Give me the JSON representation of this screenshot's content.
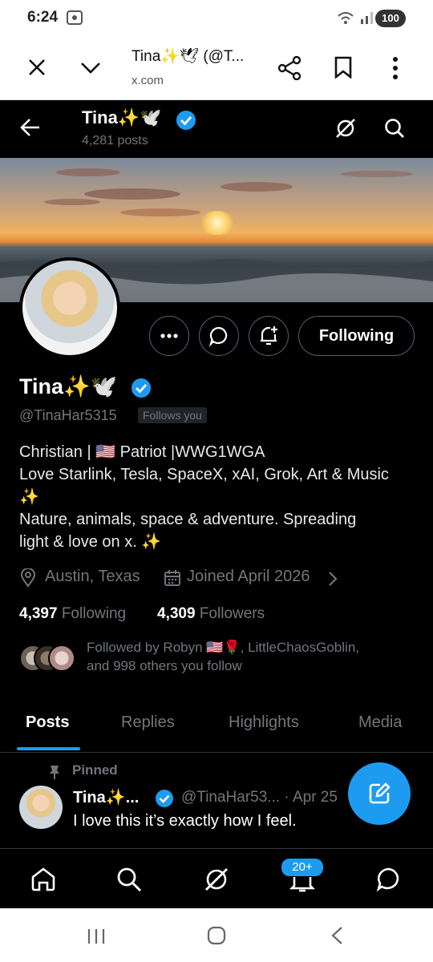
{
  "status_bar": {
    "time": "6:24",
    "battery": "100"
  },
  "custom_tab": {
    "title": "Tina✨🕊 (@T...",
    "url": "x.com"
  },
  "header": {
    "name": "Tina✨🕊️",
    "post_count": "4,281 posts"
  },
  "profile": {
    "name": "Tina✨🕊️",
    "handle": "@TinaHar5315",
    "follows_you": "Follows you",
    "follow_button": "Following",
    "bio": [
      "Christian | 🇺🇸 Patriot |WWG1WGA",
      "Love Starlink, Tesla, SpaceX, xAI, Grok, Art & Music",
      "✨",
      "Nature, animals, space & adventure. Spreading",
      "light & love on x. ✨"
    ],
    "location": "Austin, Texas",
    "joined": "Joined April 2026",
    "following_count": "4,397",
    "following_label": "Following",
    "followers_count": "4,309",
    "followers_label": "Followers",
    "followed_by_line1": "Followed by Robyn 🇺🇸🌹, LittleChaosGoblin,",
    "followed_by_line2": "and 998 others you follow"
  },
  "tabs": [
    "Posts",
    "Replies",
    "Highlights",
    "Media"
  ],
  "active_tab": "Posts",
  "pinned_post": {
    "pinned_label": "Pinned",
    "author": "Tina✨...",
    "handle_date": "@TinaHar53... · Apr 25",
    "text": "I love this it’s exactly how I feel."
  },
  "bottom_nav": {
    "notifications_badge": "20+"
  },
  "icons": [
    "close-icon",
    "chevron-down-icon",
    "share-icon",
    "bookmark-icon",
    "more-vertical-icon",
    "back-arrow-icon",
    "grok-icon",
    "search-icon",
    "verified-badge-icon",
    "more-icon",
    "message-icon",
    "notify-add-icon",
    "location-icon",
    "calendar-icon",
    "pin-icon",
    "compose-icon",
    "home-icon",
    "bell-icon",
    "chat-icon"
  ],
  "colors": {
    "accent": "#1d9bf0",
    "background": "#000000",
    "muted": "#71767b"
  }
}
